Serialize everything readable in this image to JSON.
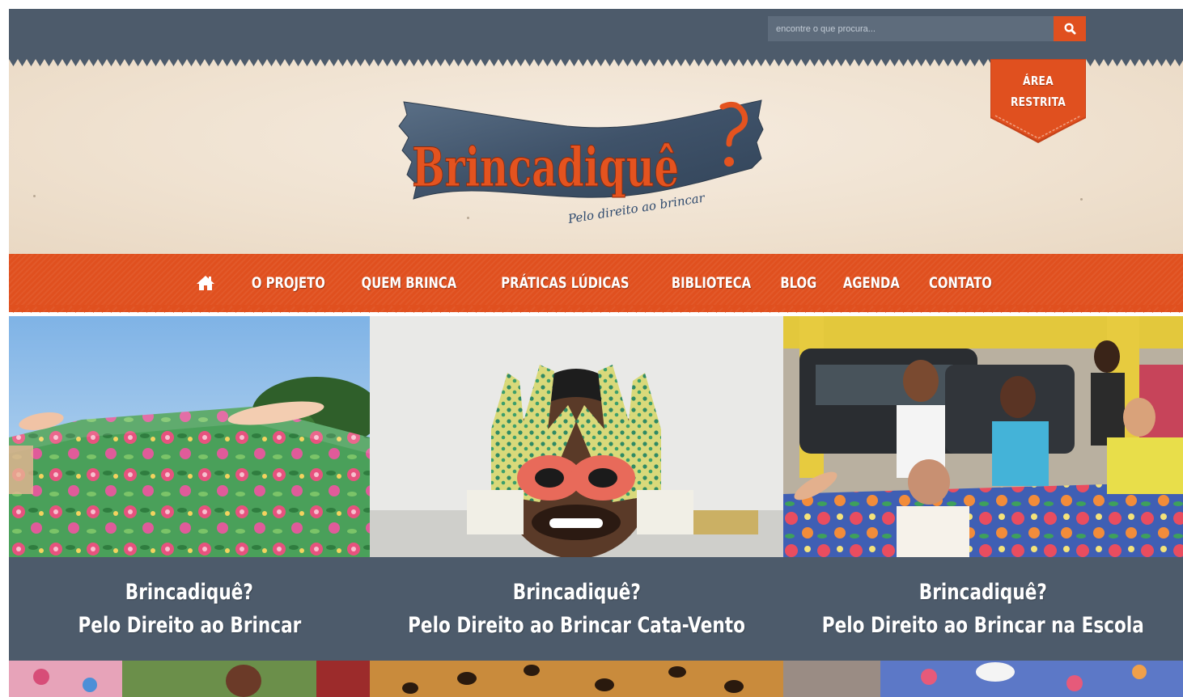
{
  "search": {
    "placeholder": "encontre o que procura..."
  },
  "icons": {
    "search": "search-icon",
    "home": "home-icon"
  },
  "header": {
    "logo": {
      "title": "Brincadiquê",
      "tagline": "Pelo direito ao brincar"
    },
    "area_restrita": {
      "line1": "ÁREA",
      "line2": "RESTRITA"
    }
  },
  "nav": {
    "items": [
      {
        "label": "O PROJETO"
      },
      {
        "label": "QUEM BRINCA"
      },
      {
        "label": "PRÁTICAS LÚDICAS"
      },
      {
        "label": "BIBLIOTECA"
      },
      {
        "label": "BLOG"
      },
      {
        "label": "AGENDA"
      },
      {
        "label": "CONTATO"
      }
    ]
  },
  "cards": [
    {
      "title": "Brincadiquê?",
      "subtitle": "Pelo Direito ao Brincar"
    },
    {
      "title": "Brincadiquê?",
      "subtitle": "Pelo Direito ao Brincar Cata-Vento"
    },
    {
      "title": "Brincadiquê?",
      "subtitle": "Pelo Direito ao Brincar na Escola"
    }
  ],
  "colors": {
    "topbar": "#4d5b6b",
    "accent": "#e0501f",
    "cream": "#efe1cf",
    "caption_bg": "#4d5b6b"
  }
}
